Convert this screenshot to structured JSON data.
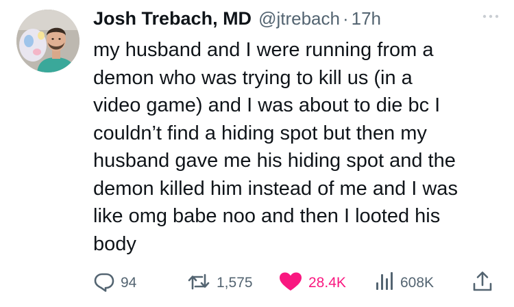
{
  "tweet": {
    "author": {
      "name": "Josh Trebach, MD",
      "handle": "@jtrebach",
      "separator": "·",
      "time": "17h"
    },
    "text_lines": [
      "my husband and I were running from a",
      "demon who was trying to kill us (in a",
      "video game) and I was about to die bc I",
      "couldn’t find a hiding spot but then my",
      "husband gave me his hiding spot and the",
      "demon killed him instead of me and I was",
      "like omg babe noo and then I looted his",
      "body"
    ],
    "stats": {
      "replies": "94",
      "reposts": "1,575",
      "likes": "28.4K",
      "views": "608K"
    }
  },
  "icons": {
    "more": "more-icon",
    "reply": "reply-icon",
    "repost": "repost-icon",
    "like": "heart-icon",
    "views": "views-icon",
    "share": "share-icon"
  },
  "colors": {
    "text": "#0f1419",
    "secondary": "#536471",
    "like": "#f91880"
  }
}
